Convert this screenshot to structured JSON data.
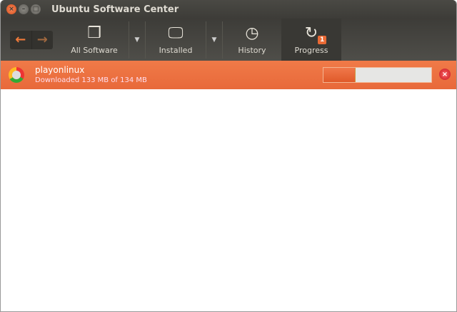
{
  "window": {
    "title": "Ubuntu Software Center"
  },
  "toolbar": {
    "all_software": "All Software",
    "installed": "Installed",
    "history": "History",
    "progress": "Progress",
    "progress_badge": "1"
  },
  "download": {
    "name": "playonlinux",
    "status": "Downloaded 133 MB of 134 MB",
    "progress_fraction": 0.3
  },
  "colors": {
    "accent": "#ea6a35"
  }
}
